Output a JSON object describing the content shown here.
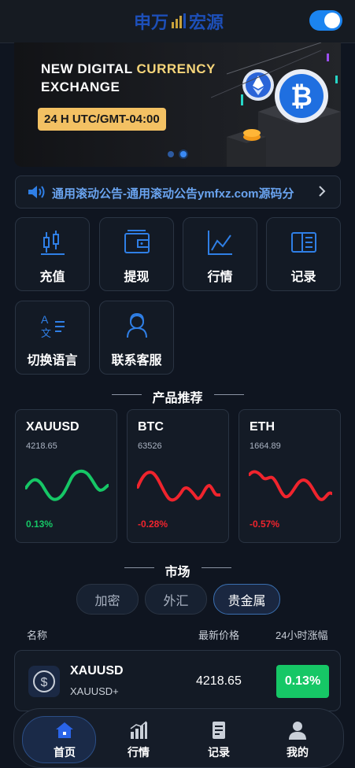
{
  "header": {
    "logo_text_left": "申万",
    "logo_text_right": "宏源",
    "theme_toggle_on": true
  },
  "banner": {
    "title_line1_white": "NEW DIGITAL ",
    "title_line1_highlight": "CURRENCY",
    "title_line2": "EXCHANGE",
    "badge": "24 H UTC/GMT-04:00",
    "slides": 2,
    "active_slide": 2
  },
  "notice": {
    "text": "通用滚动公告-通用滚动公告ymfxz.com源码分"
  },
  "quick_actions": [
    {
      "label": "充值",
      "icon": "candlestick-icon"
    },
    {
      "label": "提现",
      "icon": "wallet-icon"
    },
    {
      "label": "行情",
      "icon": "line-chart-icon"
    },
    {
      "label": "记录",
      "icon": "record-book-icon"
    },
    {
      "label": "切换语言",
      "icon": "translate-icon"
    },
    {
      "label": "联系客服",
      "icon": "customer-service-icon"
    }
  ],
  "products_section": {
    "title": "产品推荐",
    "items": [
      {
        "symbol": "XAUUSD",
        "price": "4218.65",
        "change": "0.13%",
        "trend": "up",
        "color": "#16c766"
      },
      {
        "symbol": "BTC",
        "price": "63526",
        "change": "-0.28%",
        "trend": "down",
        "color": "#f0242d"
      },
      {
        "symbol": "ETH",
        "price": "1664.89",
        "change": "-0.57%",
        "trend": "down",
        "color": "#f0242d"
      }
    ]
  },
  "market": {
    "title": "市场",
    "tabs": [
      "加密",
      "外汇",
      "贵金属"
    ],
    "active_tab": 2,
    "columns": {
      "name": "名称",
      "price": "最新价格",
      "change": "24小时涨幅"
    },
    "rows": [
      {
        "symbol": "XAUUSD",
        "sub": "XAUUSD+",
        "price": "4218.65",
        "change": "0.13%",
        "icon": "dollar-coin-icon"
      }
    ]
  },
  "tabbar": {
    "items": [
      {
        "label": "首页",
        "icon": "home-icon"
      },
      {
        "label": "行情",
        "icon": "bar-chart-icon"
      },
      {
        "label": "记录",
        "icon": "document-icon"
      },
      {
        "label": "我的",
        "icon": "user-icon"
      }
    ],
    "active": 0
  },
  "colors": {
    "accent": "#1b84f0",
    "up": "#16c766",
    "down": "#f0242d",
    "badge_gold": "#f3c163"
  }
}
